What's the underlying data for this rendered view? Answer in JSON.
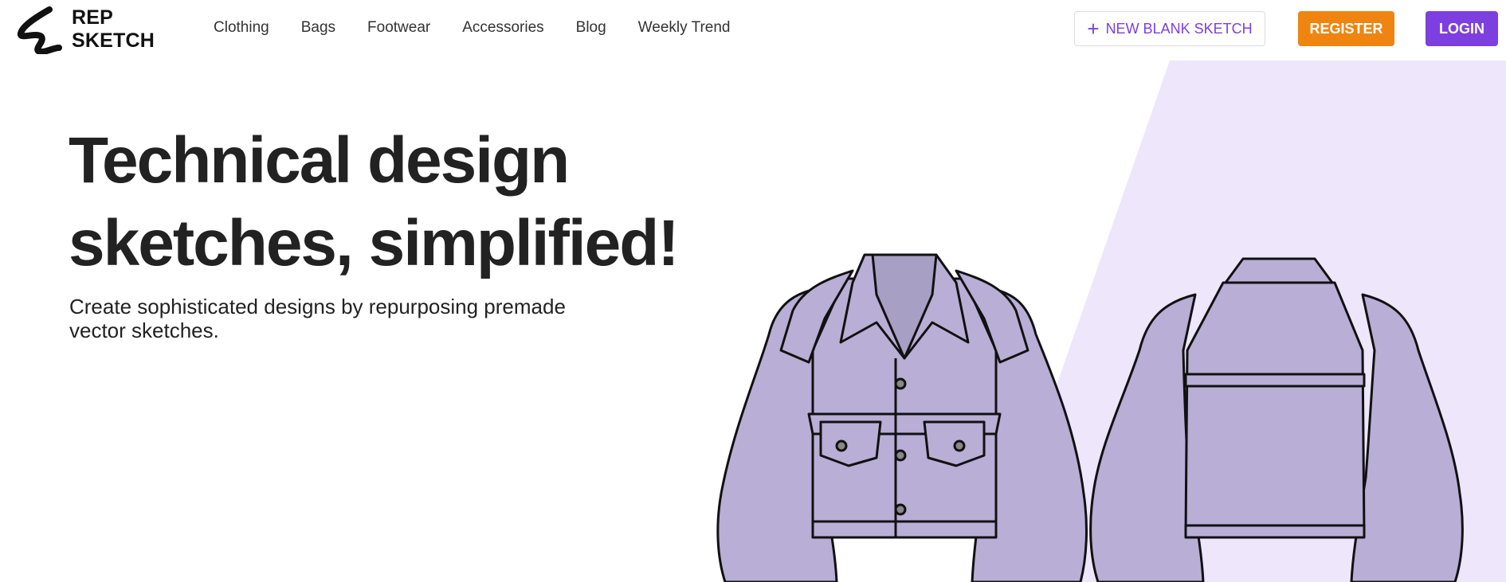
{
  "brand": {
    "line1": "REP",
    "line2": "SKETCH",
    "logo_icon": "squiggle-logo-icon"
  },
  "nav": {
    "items": [
      "Clothing",
      "Bags",
      "Footwear",
      "Accessories",
      "Blog",
      "Weekly Trend"
    ]
  },
  "actions": {
    "new_sketch_label": "NEW BLANK SKETCH",
    "new_sketch_icon": "plus-icon",
    "register_label": "REGISTER",
    "login_label": "LOGIN"
  },
  "hero": {
    "title_line1": "Technical design",
    "title_line2": "sketches, simplified!",
    "subtitle_line1": "Create sophisticated designs by repurposing premade",
    "subtitle_line2": "vector sketches."
  },
  "colors": {
    "accent_purple": "#7d3fe0",
    "accent_orange": "#f08410",
    "hero_tint": "#eee6fb",
    "garment_fill": "#b9aed6"
  }
}
